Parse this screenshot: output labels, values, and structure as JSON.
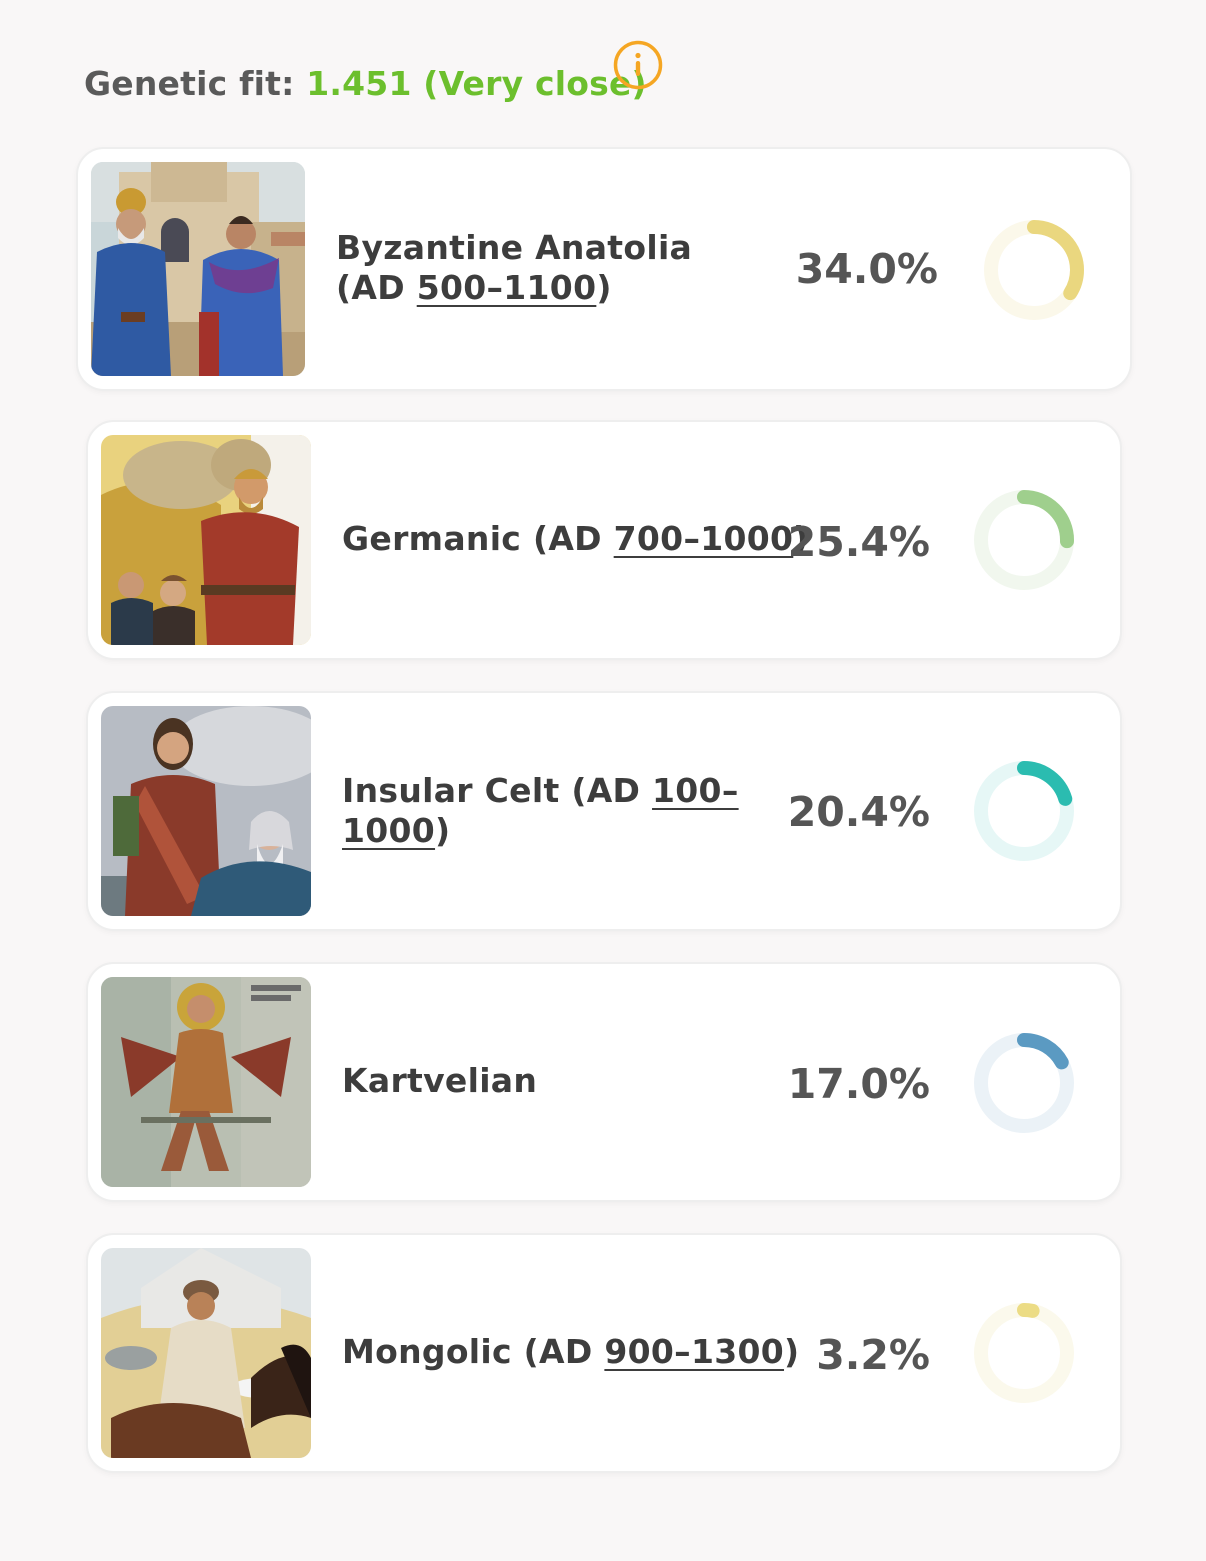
{
  "header": {
    "label": "Genetic fit:",
    "value": "1.451 (Very close)",
    "value_color": "#6cbf2d",
    "info_icon": "info-circle-icon",
    "info_color": "#f5a623"
  },
  "populations": [
    {
      "name_prefix": "Byzantine Anatolia",
      "name_mid": "(AD ",
      "period": "500–1100",
      "name_suffix": ")",
      "percent_text": "34.0%",
      "percent": 34.0,
      "ring_color": "#ead77f",
      "track_color": "#fbf8ea",
      "image": "byzantine-illustration"
    },
    {
      "name_prefix": "Germanic (AD ",
      "period": "700–1000",
      "name_suffix": ")",
      "percent_text": "25.4%",
      "percent": 25.4,
      "ring_color": "#9fcf8d",
      "track_color": "#f1f7ee",
      "image": "germanic-illustration"
    },
    {
      "name_prefix": "Insular Celt (AD ",
      "period_a": "100–",
      "period_b": "1000",
      "name_suffix": ")",
      "percent_text": "20.4%",
      "percent": 20.4,
      "ring_color": "#2bbcb0",
      "track_color": "#e6f7f6",
      "image": "celt-illustration"
    },
    {
      "name_prefix": "Kartvelian",
      "percent_text": "17.0%",
      "percent": 17.0,
      "ring_color": "#5b9ac2",
      "track_color": "#ebf2f7",
      "image": "kartvelian-fresco"
    },
    {
      "name_prefix": "Mongolic (AD ",
      "period": "900–1300",
      "name_suffix": ")",
      "percent_text": "3.2%",
      "percent": 3.2,
      "ring_color": "#ecdc85",
      "track_color": "#fbf9ec",
      "image": "mongolic-illustration"
    }
  ]
}
